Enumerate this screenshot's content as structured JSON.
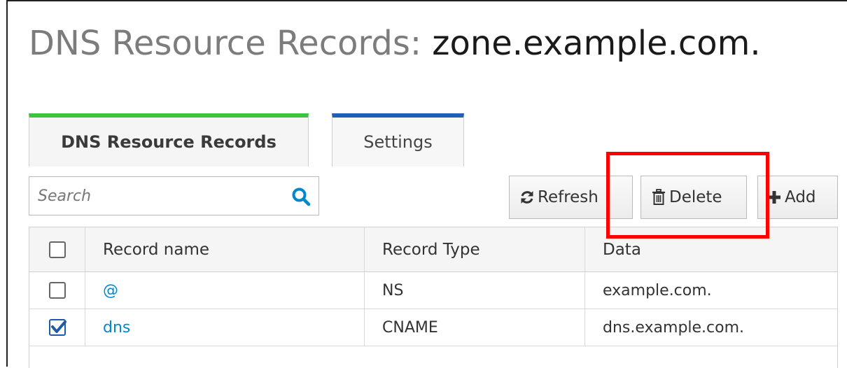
{
  "header": {
    "title_prefix": "DNS Resource Records:",
    "zone_name": "zone.example.com."
  },
  "tabs": [
    {
      "label": "DNS Resource Records",
      "active": true,
      "accent": "#3ec33e"
    },
    {
      "label": "Settings",
      "active": false,
      "accent": "#1f5fb5"
    }
  ],
  "search": {
    "placeholder": "Search",
    "value": "",
    "icon": "search-icon"
  },
  "toolbar": {
    "refresh_label": "Refresh",
    "delete_label": "Delete",
    "add_label": "Add"
  },
  "table": {
    "columns": [
      "Record name",
      "Record Type",
      "Data"
    ],
    "rows": [
      {
        "name": "@",
        "type": "NS",
        "data": "example.com.",
        "checked": false
      },
      {
        "name": "dns",
        "type": "CNAME",
        "data": "dns.example.com.",
        "checked": true
      }
    ]
  },
  "colors": {
    "link": "#0088ce",
    "annotation": "#ff0000",
    "checkbox_checked": "#1d5aa8"
  }
}
